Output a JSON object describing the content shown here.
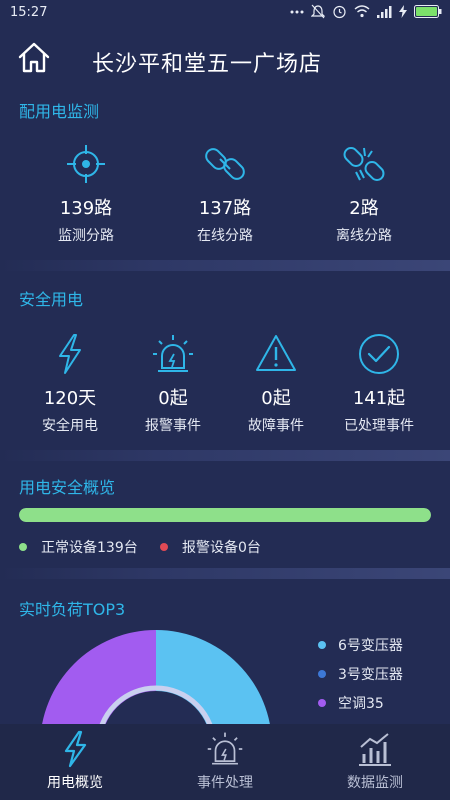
{
  "status_bar": {
    "time": "15:27"
  },
  "header": {
    "title": "长沙平和堂五一广场店"
  },
  "power_monitor": {
    "title": "配用电监测",
    "items": [
      {
        "value": "139路",
        "label": "监测分路",
        "icon": "crosshair-icon"
      },
      {
        "value": "137路",
        "label": "在线分路",
        "icon": "link-icon"
      },
      {
        "value": "2路",
        "label": "离线分路",
        "icon": "broken-link-icon"
      }
    ]
  },
  "safety": {
    "title": "安全用电",
    "items": [
      {
        "value": "120天",
        "label": "安全用电",
        "icon": "lightning-icon"
      },
      {
        "value": "0起",
        "label": "报警事件",
        "icon": "alarm-light-icon"
      },
      {
        "value": "0起",
        "label": "故障事件",
        "icon": "warning-icon"
      },
      {
        "value": "141起",
        "label": "已处理事件",
        "icon": "check-circle-icon"
      }
    ]
  },
  "overview": {
    "title": "用电安全概览",
    "normal_fraction": 1.0,
    "normal_label": "正常设备139台",
    "alarm_label": "报警设备0台",
    "normal_color": "#8ee08a",
    "alarm_color": "#e04a55"
  },
  "load_top3": {
    "title": "实时负荷TOP3",
    "legend": [
      {
        "name": "6号变压器",
        "color": "#5bc2f2"
      },
      {
        "name": "3号变压器",
        "color": "#3d78d6"
      },
      {
        "name": "空调35",
        "color": "#a25cf0"
      }
    ]
  },
  "tabs": [
    {
      "label": "用电概览",
      "icon": "lightning-tab-icon",
      "active": true
    },
    {
      "label": "事件处理",
      "icon": "alarm-light-tab-icon",
      "active": false
    },
    {
      "label": "数据监测",
      "icon": "bar-chart-tab-icon",
      "active": false
    }
  ],
  "colors": {
    "accent": "#2fb6e8",
    "background": "#232c54"
  }
}
